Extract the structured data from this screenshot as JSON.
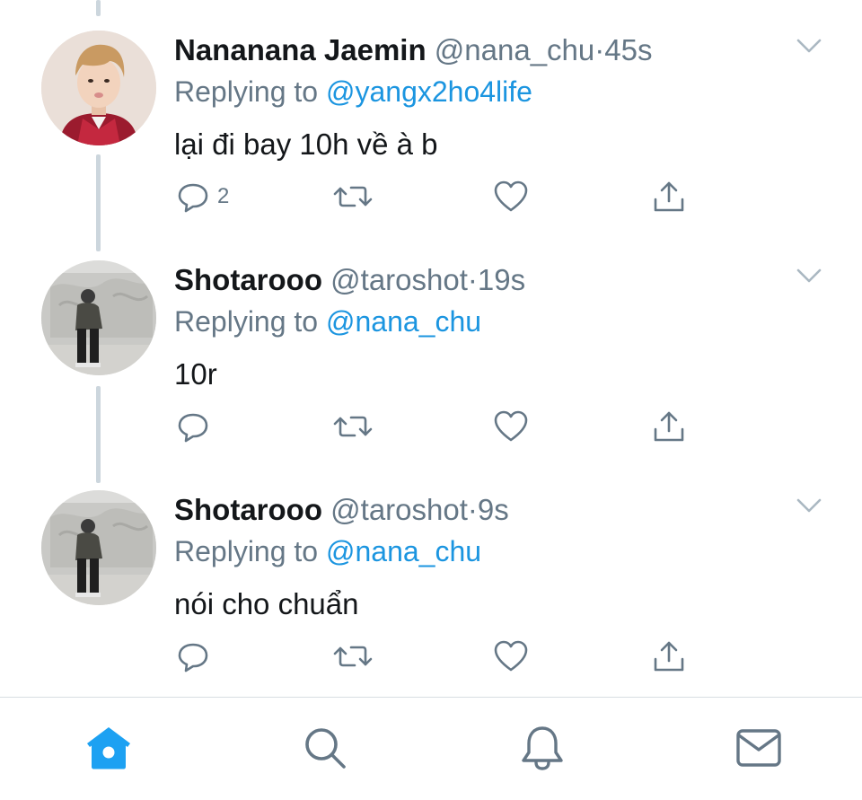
{
  "colors": {
    "accent": "#1b95e0",
    "muted": "#657786",
    "text": "#14171a",
    "thread_line": "#ccd6dd"
  },
  "tweets": [
    {
      "display_name": "Nananana Jaemin",
      "handle": "@nana_chu",
      "separator": "·",
      "time": "45s",
      "replying_prefix": "Replying to",
      "replying_to": "@yangx2ho4life",
      "text": "lại đi bay 10h về à b",
      "reply_count": "2"
    },
    {
      "display_name": "Shotarooo",
      "handle": "@taroshot",
      "separator": "·",
      "time": "19s",
      "replying_prefix": "Replying to",
      "replying_to": "@nana_chu",
      "text": "10r",
      "reply_count": ""
    },
    {
      "display_name": "Shotarooo",
      "handle": "@taroshot",
      "separator": "·",
      "time": "9s",
      "replying_prefix": "Replying to",
      "replying_to": "@nana_chu",
      "text": "nói cho chuẩn",
      "reply_count": ""
    }
  ],
  "tabbar": {
    "items": [
      {
        "icon": "home-icon",
        "active": true
      },
      {
        "icon": "search-icon",
        "active": false
      },
      {
        "icon": "bell-icon",
        "active": false
      },
      {
        "icon": "mail-icon",
        "active": false
      }
    ]
  }
}
